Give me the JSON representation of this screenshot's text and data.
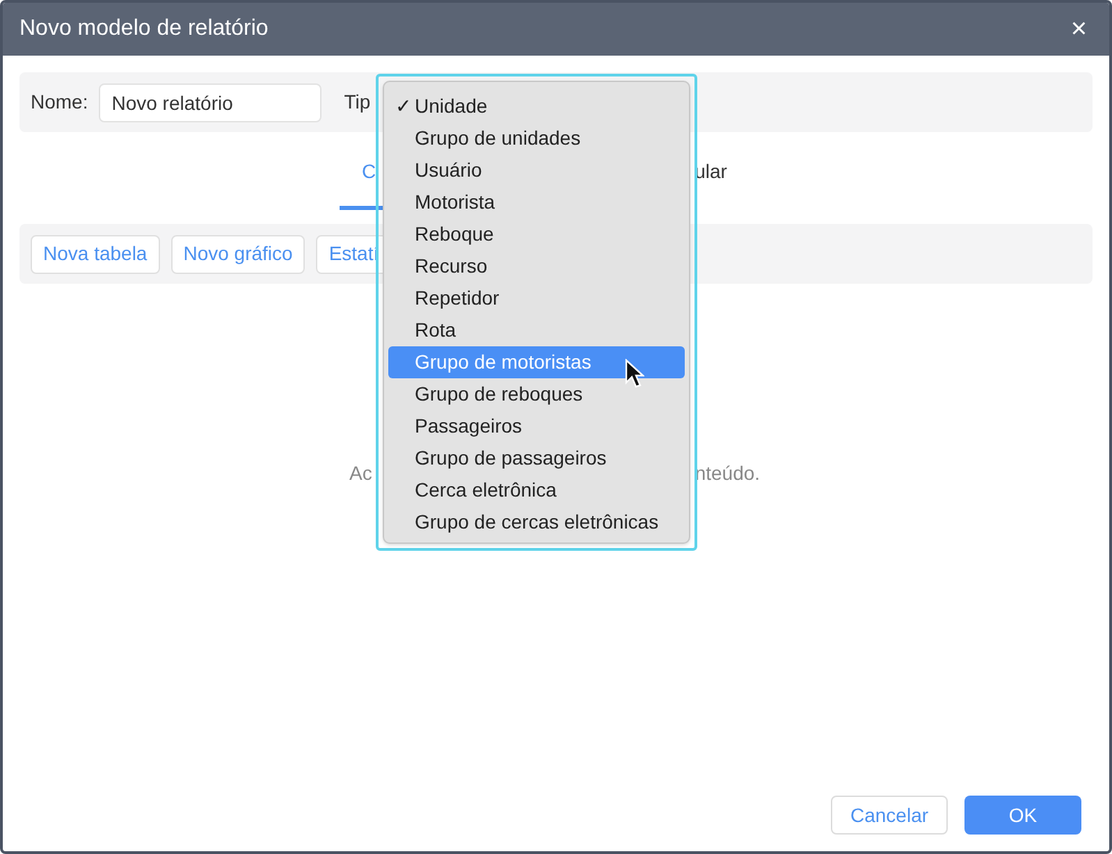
{
  "window": {
    "title": "Novo modelo de relatório",
    "close": "×"
  },
  "form": {
    "name_label": "Nome:",
    "name_value": "Novo relatório",
    "type_label": "Tip"
  },
  "tabs": [
    {
      "label": "C",
      "selected": true
    },
    {
      "label": "ular",
      "selected": false
    }
  ],
  "toolbar": [
    "Nova tabela",
    "Novo gráfico",
    "Estatí"
  ],
  "empty_message": {
    "left": "Ac",
    "right": "nteúdo."
  },
  "dropdown": [
    {
      "label": "Unidade",
      "checked": true,
      "highlighted": false
    },
    {
      "label": "Grupo de unidades",
      "checked": false,
      "highlighted": false
    },
    {
      "label": "Usuário",
      "checked": false,
      "highlighted": false
    },
    {
      "label": "Motorista",
      "checked": false,
      "highlighted": false
    },
    {
      "label": "Reboque",
      "checked": false,
      "highlighted": false
    },
    {
      "label": "Recurso",
      "checked": false,
      "highlighted": false
    },
    {
      "label": "Repetidor",
      "checked": false,
      "highlighted": false
    },
    {
      "label": "Rota",
      "checked": false,
      "highlighted": false
    },
    {
      "label": "Grupo de motoristas",
      "checked": false,
      "highlighted": true
    },
    {
      "label": "Grupo de reboques",
      "checked": false,
      "highlighted": false
    },
    {
      "label": "Passageiros",
      "checked": false,
      "highlighted": false
    },
    {
      "label": "Grupo de passageiros",
      "checked": false,
      "highlighted": false
    },
    {
      "label": "Cerca eletrônica",
      "checked": false,
      "highlighted": false
    },
    {
      "label": "Grupo de cercas eletrônicas",
      "checked": false,
      "highlighted": false
    }
  ],
  "check_mark": "✓",
  "buttons": [
    {
      "label": "Cancelar",
      "kind": "secondary"
    },
    {
      "label": "OK",
      "kind": "primary"
    }
  ]
}
